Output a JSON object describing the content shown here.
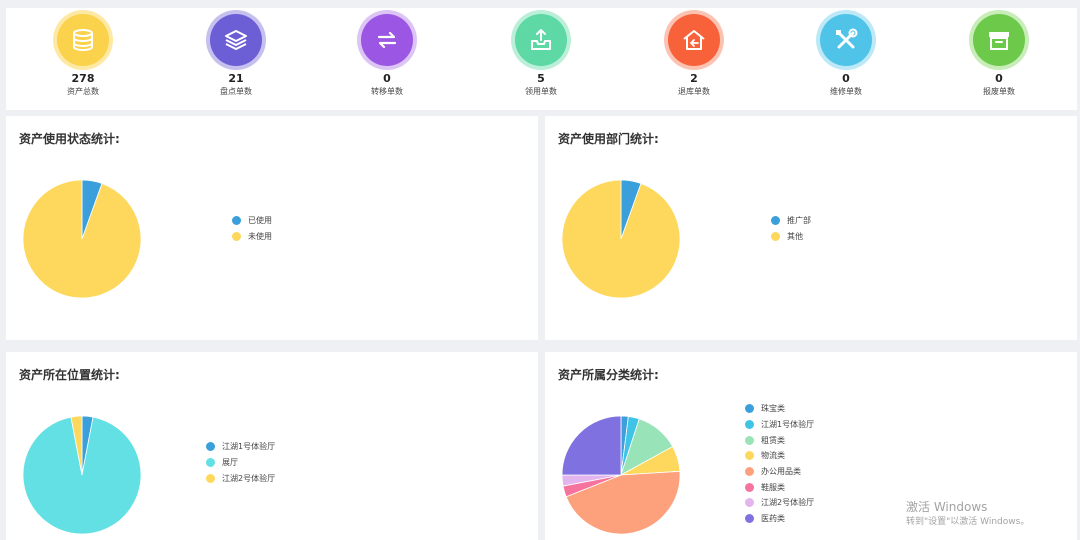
{
  "stats": [
    {
      "count": "278",
      "label": "资产总数",
      "color": "#fbd24b",
      "ring": "#fde9a3",
      "icon": "coin-stack-icon"
    },
    {
      "count": "21",
      "label": "盘点单数",
      "color": "#6c5fd6",
      "ring": "#c6c0ef",
      "icon": "layers-icon"
    },
    {
      "count": "0",
      "label": "转移单数",
      "color": "#9b56e3",
      "ring": "#dcc4f5",
      "icon": "transfer-icon"
    },
    {
      "count": "5",
      "label": "领用单数",
      "color": "#5ed8a5",
      "ring": "#bcefd9",
      "icon": "inbox-upload-icon"
    },
    {
      "count": "2",
      "label": "退库单数",
      "color": "#f8623a",
      "ring": "#fcc3b3",
      "icon": "return-home-icon"
    },
    {
      "count": "0",
      "label": "维修单数",
      "color": "#4fc3e8",
      "ring": "#bde8f6",
      "icon": "tools-icon"
    },
    {
      "count": "0",
      "label": "报废单数",
      "color": "#6cc94a",
      "ring": "#c8edb9",
      "icon": "archive-box-icon"
    }
  ],
  "panels": [
    {
      "title": "资产使用状态统计:",
      "chart_data": {
        "type": "pie",
        "categories": [
          "已使用",
          "未使用"
        ],
        "values": [
          0.055,
          0.945
        ],
        "colors": [
          "#3a9fdb",
          "#fdd85d"
        ],
        "legend": "right"
      }
    },
    {
      "title": "资产使用部门统计:",
      "chart_data": {
        "type": "pie",
        "categories": [
          "推广部",
          "其他"
        ],
        "values": [
          0.055,
          0.945
        ],
        "colors": [
          "#3a9fdb",
          "#fdd85d"
        ],
        "legend": "right"
      }
    },
    {
      "title": "资产所在位置统计:",
      "chart_data": {
        "type": "pie",
        "categories": [
          "江湖1号体验厅",
          "展厅",
          "江湖2号体验厅"
        ],
        "values": [
          0.03,
          0.94,
          0.03
        ],
        "colors": [
          "#3a9fdb",
          "#62e0e3",
          "#fdd85d"
        ],
        "legend": "right"
      }
    },
    {
      "title": "资产所属分类统计:",
      "chart_data": {
        "type": "pie",
        "categories": [
          "珠宝类",
          "江湖1号体验厅",
          "租赁类",
          "物流类",
          "办公用品类",
          "鞋服类",
          "江湖2号体验厅",
          "医药类"
        ],
        "values": [
          0.02,
          0.03,
          0.12,
          0.07,
          0.45,
          0.03,
          0.03,
          0.25
        ],
        "colors": [
          "#3a9fdb",
          "#3fc4e8",
          "#98e3b8",
          "#fdd85d",
          "#fda17d",
          "#f5739d",
          "#e2b5ef",
          "#7f71e0"
        ],
        "legend": "right"
      }
    }
  ],
  "watermark": {
    "line1": "激活 Windows",
    "line2": "转到\"设置\"以激活 Windows。"
  }
}
